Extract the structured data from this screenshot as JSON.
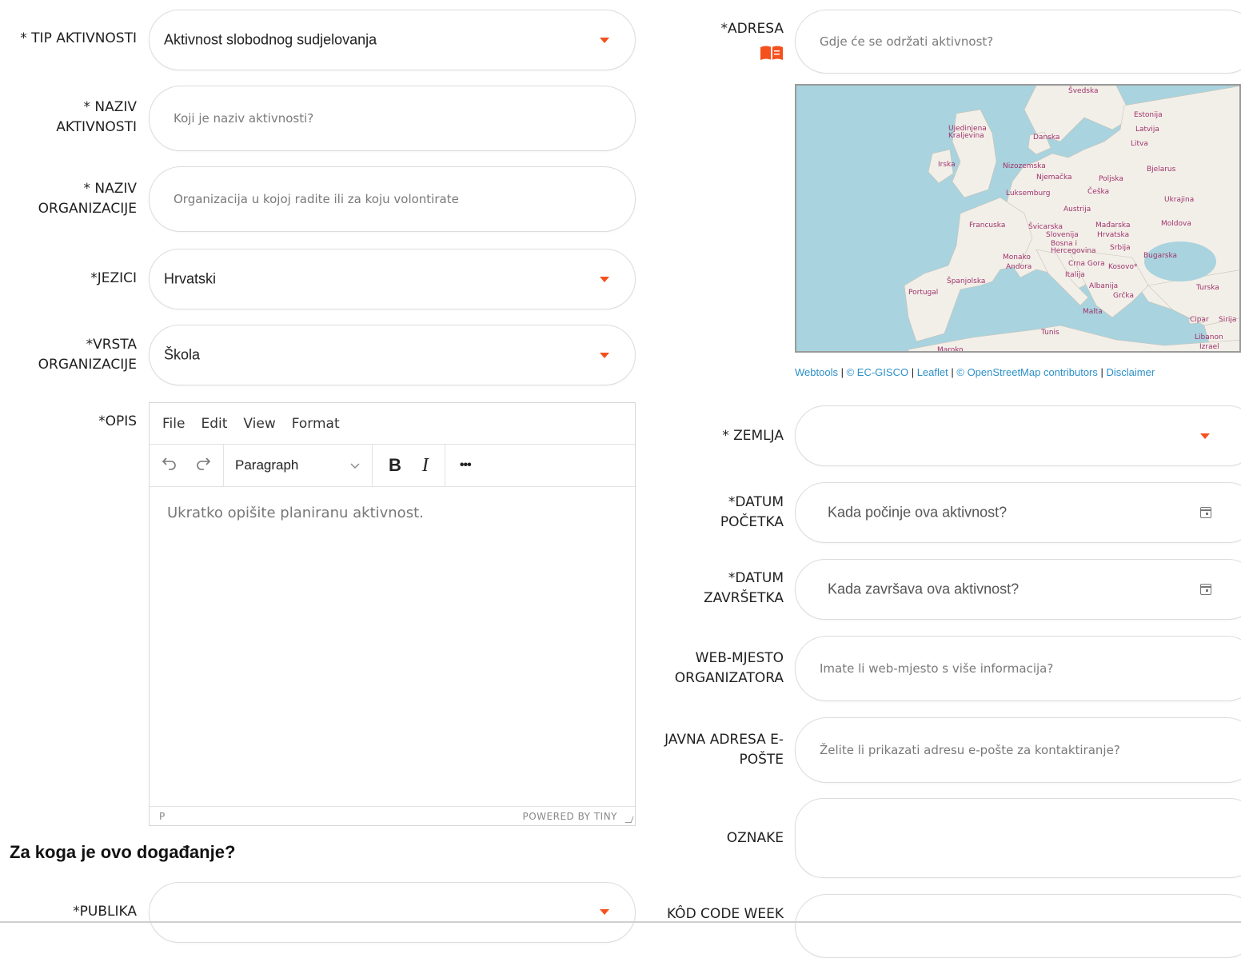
{
  "left_fields": {
    "tip": {
      "label": "* TIP AKTIVNOSTI",
      "value": "Aktivnost slobodnog sudjelovanja"
    },
    "naziv_aktivnosti": {
      "label_l1": "* NAZIV",
      "label_l2": "AKTIVNOSTI",
      "placeholder": "Koji je naziv aktivnosti?"
    },
    "naziv_organizacije": {
      "label_l1": "* NAZIV",
      "label_l2": "ORGANIZACIJE",
      "placeholder": "Organizacija u kojoj radite ili za koju volontirate"
    },
    "jezici": {
      "label": "*JEZICI",
      "value": "Hrvatski"
    },
    "vrsta": {
      "label_l1": "*VRSTA",
      "label_l2": "ORGANIZACIJE",
      "value": "Škola"
    },
    "opis": {
      "label": "*OPIS"
    }
  },
  "editor": {
    "menu": [
      "File",
      "Edit",
      "View",
      "Format"
    ],
    "block_format": "Paragraph",
    "bold": "B",
    "italic": "I",
    "more": "•••",
    "placeholder": "Ukratko opišite planiranu aktivnost.",
    "path": "P",
    "powered_by": "POWERED BY TINY"
  },
  "section": {
    "heading": "Za koga je ovo događanje?"
  },
  "publika": {
    "label": "*PUBLIKA",
    "value": ""
  },
  "right_fields": {
    "adresa": {
      "label": "*ADRESA",
      "placeholder": "Gdje će se održati aktivnost?"
    },
    "zemlja": {
      "label": "* ZEMLJA",
      "value": ""
    },
    "datum_pocetka": {
      "label_l1": "*DATUM",
      "label_l2": "POČETKA",
      "placeholder": "Kada počinje ova aktivnost?"
    },
    "datum_zavrsetka": {
      "label_l1": "*DATUM",
      "label_l2": "ZAVRŠETKA",
      "placeholder": "Kada završava ova aktivnost?"
    },
    "web": {
      "label_l1": "WEB-MJESTO",
      "label_l2": "ORGANIZATORA",
      "placeholder": "Imate li web-mjesto s više informacija?"
    },
    "email": {
      "label_l1": "JAVNA ADRESA E-",
      "label_l2": "POŠTE",
      "placeholder": "Želite li prikazati adresu e-pošte za kontaktiranje?"
    },
    "oznake": {
      "label": "OZNAKE",
      "value": ""
    },
    "kod": {
      "label": "KÔD CODE WEEK"
    }
  },
  "map": {
    "labels": [
      "Švedska",
      "Estonija",
      "Latvija",
      "Litva",
      "Ujedinjena Kraljevina",
      "Danska",
      "Irska",
      "Nizozemska",
      "Njemačka",
      "Poljska",
      "Bjelarus",
      "Luksemburg",
      "Češka",
      "Ukrajina",
      "Austrija",
      "Francuska",
      "Švicarska",
      "Mađarska",
      "Moldova",
      "Slovenija",
      "Hrvatska",
      "Bosna i Hercegovina",
      "Srbija",
      "Monako",
      "Andora",
      "Crna Gora",
      "Kosovo*",
      "Bugarska",
      "Italija",
      "Španjolska",
      "Portugal",
      "Albanija",
      "Grčka",
      "Turska",
      "Malta",
      "Tunis",
      "Cipar",
      "Sirija",
      "Libanon",
      "Izrael",
      "Maroko"
    ],
    "attribution": [
      "Webtools",
      "© EC-GISCO",
      "Leaflet",
      "© OpenStreetMap contributors",
      "Disclaimer"
    ]
  },
  "colors": {
    "accent": "#f4511e",
    "link": "#2c90c8",
    "sea": "#a9d3de",
    "land": "#f2efe9"
  }
}
